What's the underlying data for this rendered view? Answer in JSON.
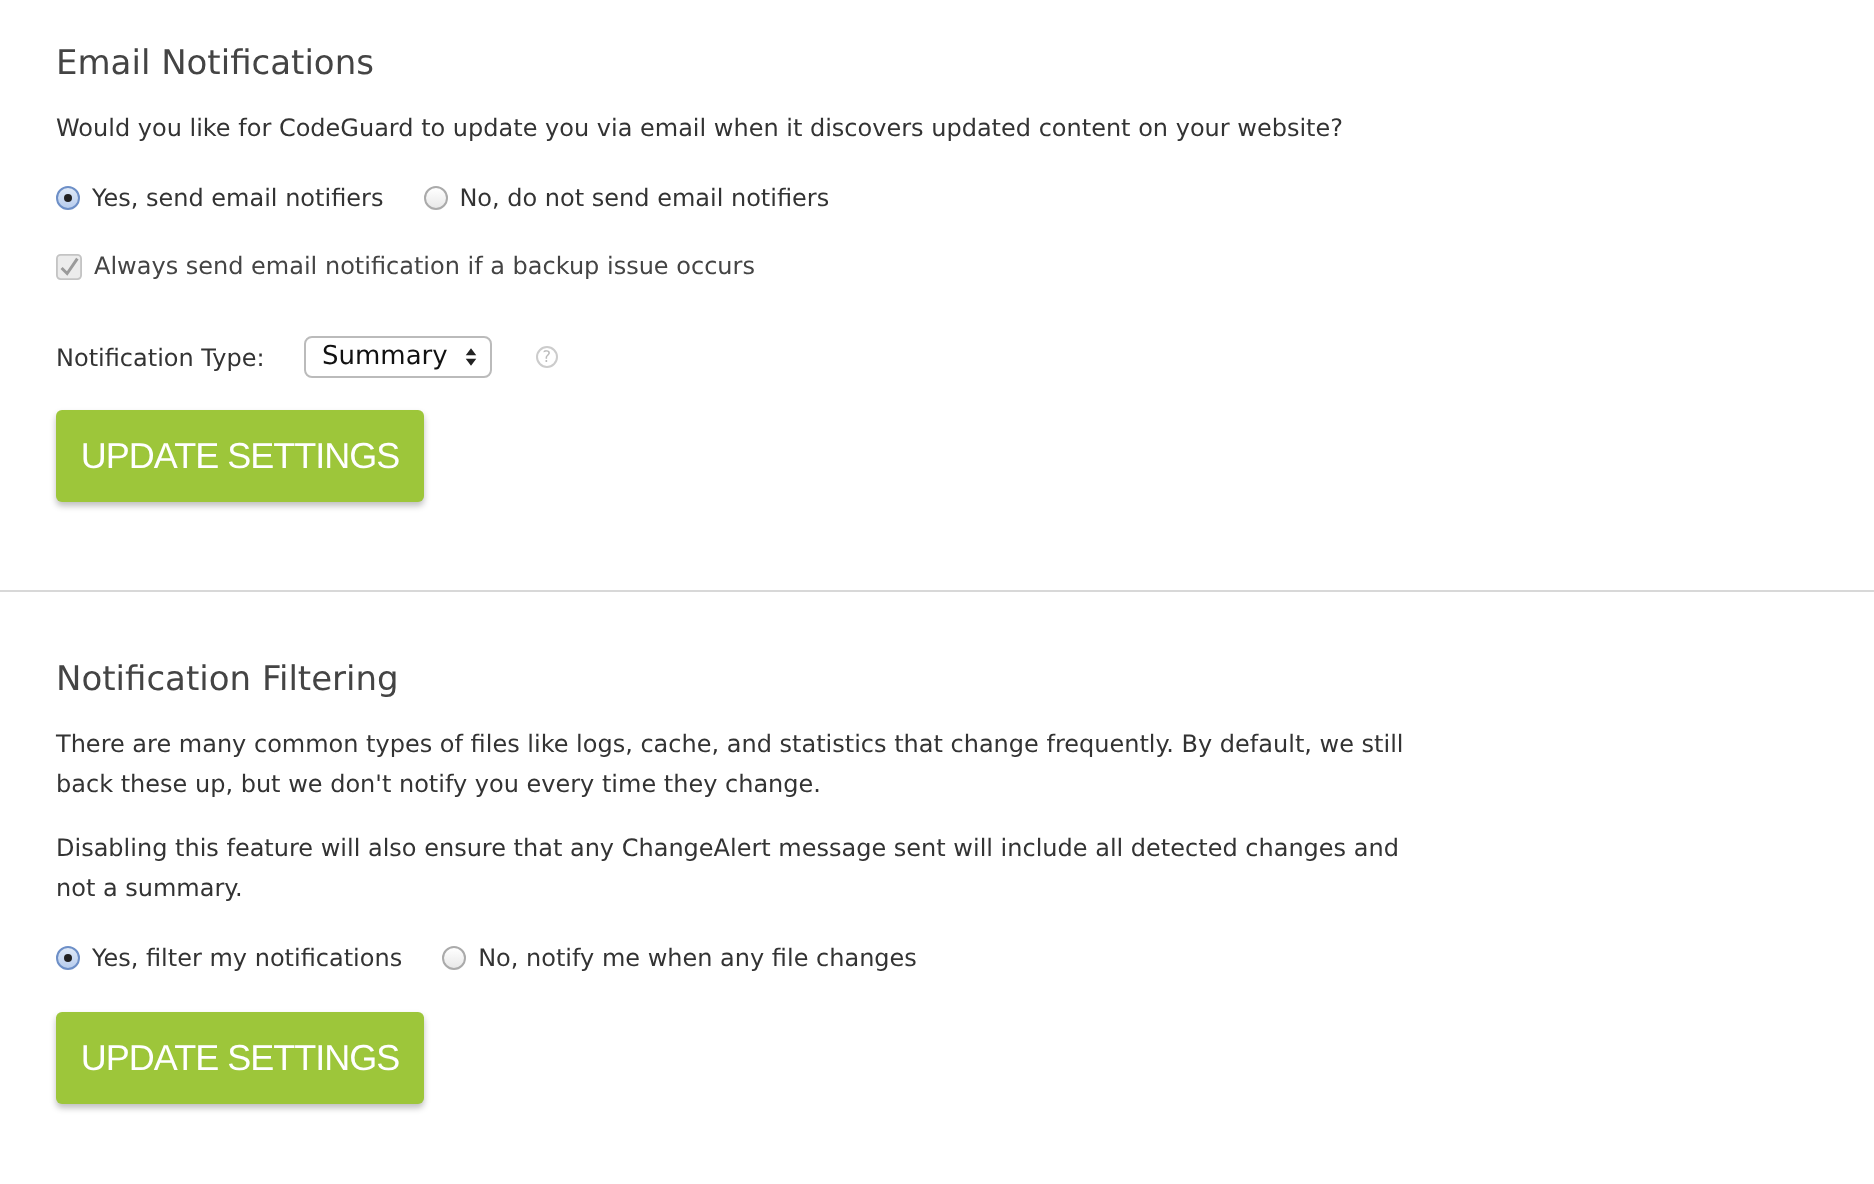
{
  "sections": [
    {
      "title": "Email Notifications",
      "paragraphs": [
        "Would you like for CodeGuard to update you via email when it discovers updated content on your website?"
      ],
      "radios": [
        {
          "label": "Yes, send email notifiers",
          "selected": true
        },
        {
          "label": "No, do not send email notifiers",
          "selected": false
        }
      ],
      "checkbox": {
        "label": "Always send email notification if a backup issue occurs",
        "checked": true,
        "disabled": true
      },
      "select": {
        "label": "Notification Type:",
        "value": "Summary",
        "help": "?"
      },
      "button": "UPDATE SETTINGS"
    },
    {
      "title": "Notification Filtering",
      "paragraphs": [
        "There are many common types of files like logs, cache, and statistics that change frequently. By default, we still back these up, but we don't notify you every time they change.",
        "Disabling this feature will also ensure that any ChangeAlert message sent will include all detected changes and not a summary."
      ],
      "radios": [
        {
          "label": "Yes, filter my notifications",
          "selected": true
        },
        {
          "label": "No, notify me when any file changes",
          "selected": false
        }
      ],
      "button": "UPDATE SETTINGS"
    }
  ]
}
